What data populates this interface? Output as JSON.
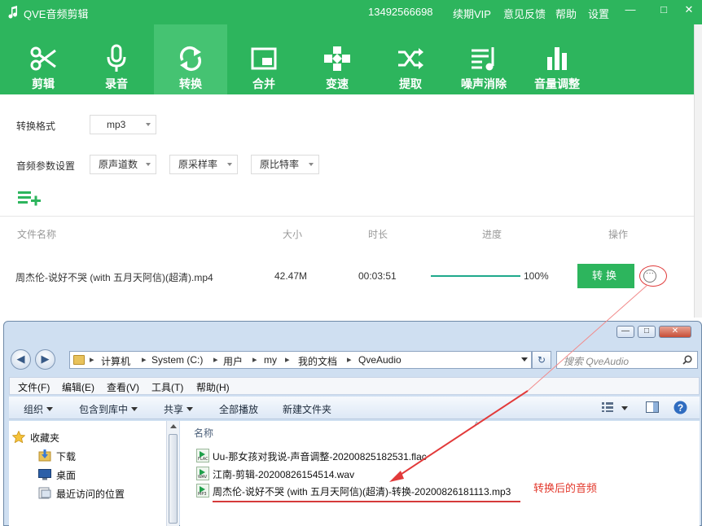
{
  "app": {
    "title": "QVE音频剪辑",
    "phone": "13492566698",
    "links": [
      "续期VIP",
      "意见反馈",
      "帮助",
      "设置"
    ],
    "window_controls": [
      "—",
      "□",
      "✕"
    ],
    "colors": {
      "brand": "#2db55d",
      "active_tab": "#45c372",
      "progress": "#1fa98c",
      "annotation": "#e2372a"
    }
  },
  "toolbar": {
    "tools": [
      {
        "label": "剪辑",
        "icon": "scissors-icon"
      },
      {
        "label": "录音",
        "icon": "microphone-icon"
      },
      {
        "label": "转换",
        "icon": "convert-icon",
        "active": true
      },
      {
        "label": "合并",
        "icon": "merge-icon"
      },
      {
        "label": "变速",
        "icon": "speed-icon"
      },
      {
        "label": "提取",
        "icon": "extract-icon"
      },
      {
        "label": "噪声消除",
        "icon": "noise-removal-icon"
      },
      {
        "label": "音量调整",
        "icon": "volume-bars-icon"
      }
    ]
  },
  "settings": {
    "format_label": "转换格式",
    "format_value": "mp3",
    "params_label": "音频参数设置",
    "channels_value": "原声道数",
    "samplerate_value": "原采样率",
    "bitrate_value": "原比特率"
  },
  "table": {
    "headers": [
      "文件名称",
      "大小",
      "时长",
      "进度",
      "操作"
    ],
    "rows": [
      {
        "name": "周杰伦-说好不哭 (with 五月天阿信)(超清).mp4",
        "size": "42.47M",
        "duration": "00:03:51",
        "progress": 1.0,
        "progress_text": "100%",
        "action_label": "转换",
        "more_label": "···"
      }
    ]
  },
  "explorer": {
    "controls": [
      "—",
      "□",
      "✕"
    ],
    "nav_back": "◀",
    "nav_forward": "▶",
    "breadcrumbs": [
      "计算机",
      "System (C:)",
      "用户",
      "my",
      "我的文档",
      "QveAudio"
    ],
    "refresh": "↻",
    "search_placeholder": "搜索 QveAudio",
    "menus": [
      "文件(F)",
      "编辑(E)",
      "查看(V)",
      "工具(T)",
      "帮助(H)"
    ],
    "commands": [
      {
        "label": "组织",
        "dropdown": true
      },
      {
        "label": "包含到库中",
        "dropdown": true
      },
      {
        "label": "共享",
        "dropdown": true
      },
      {
        "label": "全部播放",
        "dropdown": false
      },
      {
        "label": "新建文件夹",
        "dropdown": false
      }
    ],
    "nav_items": [
      "收藏夹",
      "下载",
      "桌面",
      "最近访问的位置"
    ],
    "column_header": "名称",
    "files": [
      {
        "name": "Uu-那女孩对我说-声音调整-20200825182531.flac",
        "ext": "FLAC"
      },
      {
        "name": "江南-剪辑-20200826154514.wav",
        "ext": "WAV"
      },
      {
        "name": "周杰伦-说好不哭 (with 五月天阿信)(超清)-转换-20200826181113.mp3",
        "ext": "MP3"
      }
    ],
    "annotation": "转换后的音频"
  }
}
